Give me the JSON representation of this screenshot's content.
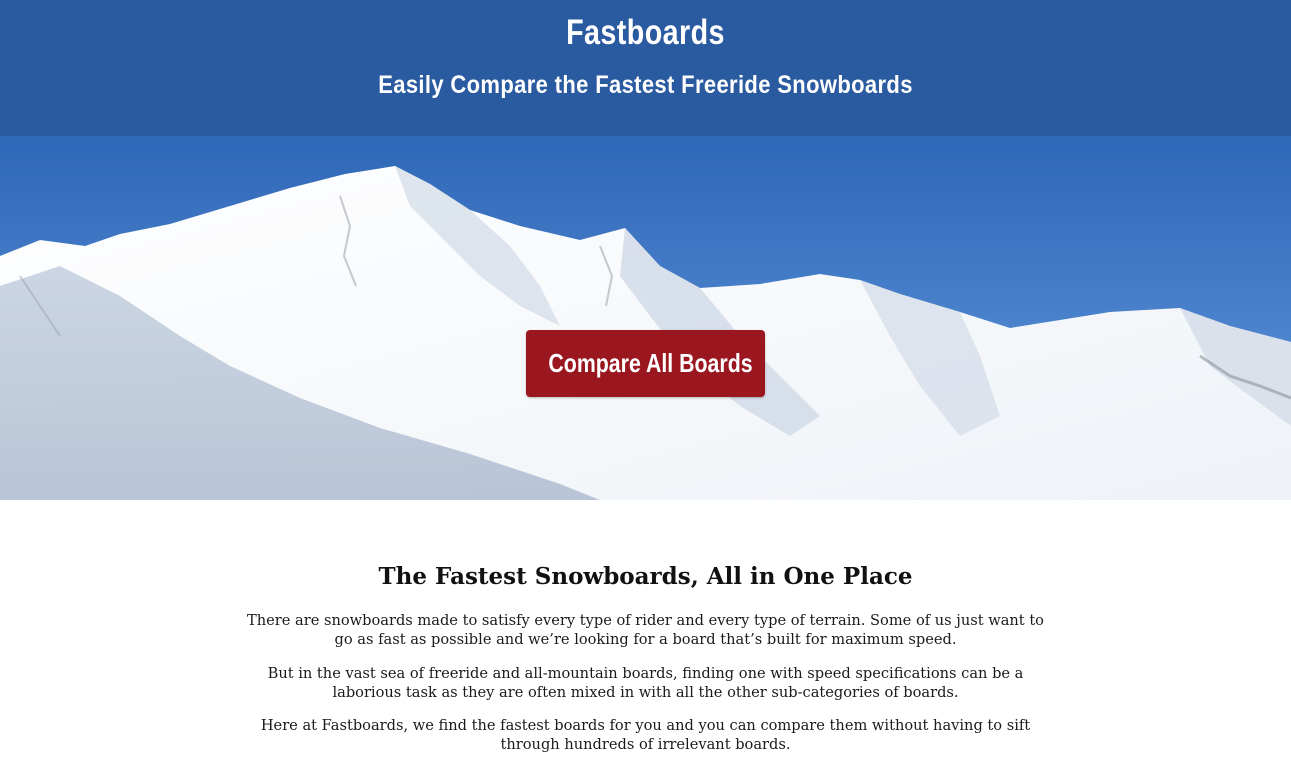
{
  "header": {
    "title": "Fastboards",
    "tagline": "Easily Compare the Fastest Freeride Snowboards"
  },
  "hero": {
    "image": "snow-covered-mountain-peak-under-blue-sky",
    "cta_label": "Compare All Boards"
  },
  "intro": {
    "heading": "The Fastest Snowboards, All in One Place",
    "paragraphs": [
      "There are snowboards made to satisfy every type of rider and every type of terrain. Some of us just want to go as fast as possible and we’re looking for a board that’s built for maximum speed.",
      "But in the vast sea of freeride and all-mountain boards, finding one with speed specifications can be a laborious task as they are often mixed in with all the other sub-categories of boards.",
      "Here at Fastboards, we find the fastest boards for you and you can compare them without having to sift through hundreds of irrelevant boards."
    ]
  },
  "colors": {
    "header_bg": "#2a5aa0",
    "cta_bg": "#9b1720",
    "sky": "#3d75c4",
    "text": "#111111"
  }
}
